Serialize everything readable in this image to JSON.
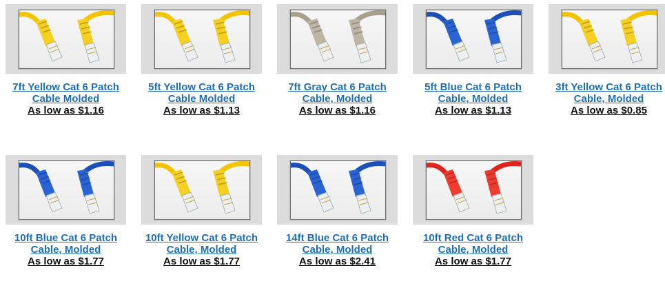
{
  "products": [
    {
      "title": "7ft Yellow Cat 6 Patch Cable Molded",
      "price": "As low as $1.16",
      "cable_color": "#f2c500",
      "boot_color": "#f6d020",
      "image_name": "yellow-patch-cable-image"
    },
    {
      "title": "5ft Yellow Cat 6 Patch Cable Molded",
      "price": "As low as $1.13",
      "cable_color": "#f2c500",
      "boot_color": "#f6d020",
      "image_name": "yellow-patch-cable-image"
    },
    {
      "title": "7ft Gray Cat 6 Patch Cable, Molded",
      "price": "As low as $1.16",
      "cable_color": "#a8a08e",
      "boot_color": "#bdb6a4",
      "image_name": "gray-patch-cable-image"
    },
    {
      "title": "5ft Blue Cat 6 Patch Cable, Molded",
      "price": "As low as $1.13",
      "cable_color": "#1d4fb8",
      "boot_color": "#2a63d4",
      "image_name": "blue-patch-cable-image"
    },
    {
      "title": "3ft Yellow Cat 6 Patch Cable, Molded",
      "price": "As low as $0.85",
      "cable_color": "#f2c500",
      "boot_color": "#f6d020",
      "image_name": "yellow-patch-cable-image"
    },
    {
      "title": "10ft Blue Cat 6 Patch Cable, Molded",
      "price": "As low as $1.77",
      "cable_color": "#1d4fb8",
      "boot_color": "#2a63d4",
      "image_name": "blue-patch-cable-image"
    },
    {
      "title": "10ft Yellow Cat 6 Patch Cable, Molded",
      "price": "As low as $1.77",
      "cable_color": "#f2c500",
      "boot_color": "#f6d020",
      "image_name": "yellow-patch-cable-image"
    },
    {
      "title": "14ft Blue Cat 6 Patch Cable, Molded",
      "price": "As low as $2.41",
      "cable_color": "#1d4fb8",
      "boot_color": "#2a63d4",
      "image_name": "blue-patch-cable-image"
    },
    {
      "title": "10ft Red Cat 6 Patch Cable, Molded",
      "price": "As low as $1.77",
      "cable_color": "#e0231b",
      "boot_color": "#ef3a30",
      "image_name": "red-patch-cable-image"
    }
  ],
  "colors": {
    "link": "#1f6fb6",
    "price": "#111111",
    "thumb_bg": "#dcdcdc"
  }
}
